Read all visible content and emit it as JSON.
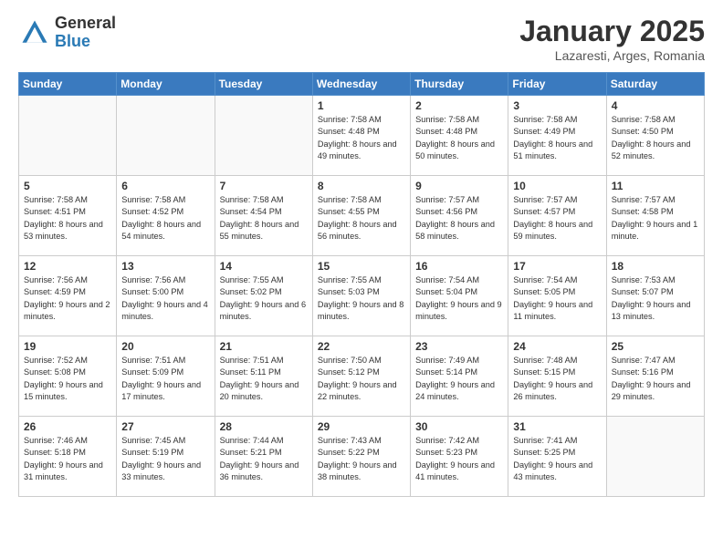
{
  "header": {
    "logo_general": "General",
    "logo_blue": "Blue",
    "month_title": "January 2025",
    "location": "Lazaresti, Arges, Romania"
  },
  "weekdays": [
    "Sunday",
    "Monday",
    "Tuesday",
    "Wednesday",
    "Thursday",
    "Friday",
    "Saturday"
  ],
  "weeks": [
    [
      {
        "day": "",
        "info": ""
      },
      {
        "day": "",
        "info": ""
      },
      {
        "day": "",
        "info": ""
      },
      {
        "day": "1",
        "info": "Sunrise: 7:58 AM\nSunset: 4:48 PM\nDaylight: 8 hours\nand 49 minutes."
      },
      {
        "day": "2",
        "info": "Sunrise: 7:58 AM\nSunset: 4:48 PM\nDaylight: 8 hours\nand 50 minutes."
      },
      {
        "day": "3",
        "info": "Sunrise: 7:58 AM\nSunset: 4:49 PM\nDaylight: 8 hours\nand 51 minutes."
      },
      {
        "day": "4",
        "info": "Sunrise: 7:58 AM\nSunset: 4:50 PM\nDaylight: 8 hours\nand 52 minutes."
      }
    ],
    [
      {
        "day": "5",
        "info": "Sunrise: 7:58 AM\nSunset: 4:51 PM\nDaylight: 8 hours\nand 53 minutes."
      },
      {
        "day": "6",
        "info": "Sunrise: 7:58 AM\nSunset: 4:52 PM\nDaylight: 8 hours\nand 54 minutes."
      },
      {
        "day": "7",
        "info": "Sunrise: 7:58 AM\nSunset: 4:54 PM\nDaylight: 8 hours\nand 55 minutes."
      },
      {
        "day": "8",
        "info": "Sunrise: 7:58 AM\nSunset: 4:55 PM\nDaylight: 8 hours\nand 56 minutes."
      },
      {
        "day": "9",
        "info": "Sunrise: 7:57 AM\nSunset: 4:56 PM\nDaylight: 8 hours\nand 58 minutes."
      },
      {
        "day": "10",
        "info": "Sunrise: 7:57 AM\nSunset: 4:57 PM\nDaylight: 8 hours\nand 59 minutes."
      },
      {
        "day": "11",
        "info": "Sunrise: 7:57 AM\nSunset: 4:58 PM\nDaylight: 9 hours\nand 1 minute."
      }
    ],
    [
      {
        "day": "12",
        "info": "Sunrise: 7:56 AM\nSunset: 4:59 PM\nDaylight: 9 hours\nand 2 minutes."
      },
      {
        "day": "13",
        "info": "Sunrise: 7:56 AM\nSunset: 5:00 PM\nDaylight: 9 hours\nand 4 minutes."
      },
      {
        "day": "14",
        "info": "Sunrise: 7:55 AM\nSunset: 5:02 PM\nDaylight: 9 hours\nand 6 minutes."
      },
      {
        "day": "15",
        "info": "Sunrise: 7:55 AM\nSunset: 5:03 PM\nDaylight: 9 hours\nand 8 minutes."
      },
      {
        "day": "16",
        "info": "Sunrise: 7:54 AM\nSunset: 5:04 PM\nDaylight: 9 hours\nand 9 minutes."
      },
      {
        "day": "17",
        "info": "Sunrise: 7:54 AM\nSunset: 5:05 PM\nDaylight: 9 hours\nand 11 minutes."
      },
      {
        "day": "18",
        "info": "Sunrise: 7:53 AM\nSunset: 5:07 PM\nDaylight: 9 hours\nand 13 minutes."
      }
    ],
    [
      {
        "day": "19",
        "info": "Sunrise: 7:52 AM\nSunset: 5:08 PM\nDaylight: 9 hours\nand 15 minutes."
      },
      {
        "day": "20",
        "info": "Sunrise: 7:51 AM\nSunset: 5:09 PM\nDaylight: 9 hours\nand 17 minutes."
      },
      {
        "day": "21",
        "info": "Sunrise: 7:51 AM\nSunset: 5:11 PM\nDaylight: 9 hours\nand 20 minutes."
      },
      {
        "day": "22",
        "info": "Sunrise: 7:50 AM\nSunset: 5:12 PM\nDaylight: 9 hours\nand 22 minutes."
      },
      {
        "day": "23",
        "info": "Sunrise: 7:49 AM\nSunset: 5:14 PM\nDaylight: 9 hours\nand 24 minutes."
      },
      {
        "day": "24",
        "info": "Sunrise: 7:48 AM\nSunset: 5:15 PM\nDaylight: 9 hours\nand 26 minutes."
      },
      {
        "day": "25",
        "info": "Sunrise: 7:47 AM\nSunset: 5:16 PM\nDaylight: 9 hours\nand 29 minutes."
      }
    ],
    [
      {
        "day": "26",
        "info": "Sunrise: 7:46 AM\nSunset: 5:18 PM\nDaylight: 9 hours\nand 31 minutes."
      },
      {
        "day": "27",
        "info": "Sunrise: 7:45 AM\nSunset: 5:19 PM\nDaylight: 9 hours\nand 33 minutes."
      },
      {
        "day": "28",
        "info": "Sunrise: 7:44 AM\nSunset: 5:21 PM\nDaylight: 9 hours\nand 36 minutes."
      },
      {
        "day": "29",
        "info": "Sunrise: 7:43 AM\nSunset: 5:22 PM\nDaylight: 9 hours\nand 38 minutes."
      },
      {
        "day": "30",
        "info": "Sunrise: 7:42 AM\nSunset: 5:23 PM\nDaylight: 9 hours\nand 41 minutes."
      },
      {
        "day": "31",
        "info": "Sunrise: 7:41 AM\nSunset: 5:25 PM\nDaylight: 9 hours\nand 43 minutes."
      },
      {
        "day": "",
        "info": ""
      }
    ]
  ]
}
